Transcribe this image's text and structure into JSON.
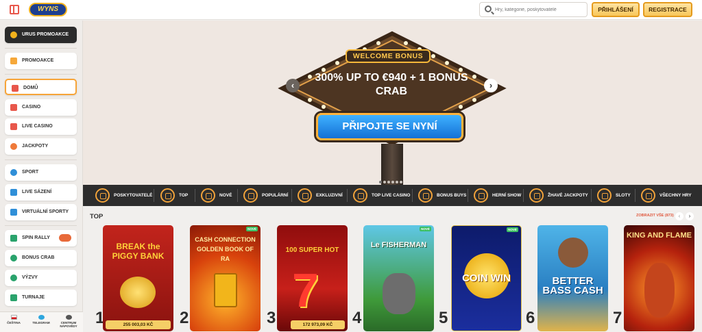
{
  "header": {
    "logo_text": "WYNS",
    "search_placeholder": "Hry, kategorie, poskytovatelé",
    "login_label": "PŘIHLÁŠENÍ",
    "register_label": "REGISTRACE"
  },
  "sidebar": {
    "items": [
      {
        "label": "URUS PROMOAKCE"
      },
      {
        "label": "PROMOAKCE"
      },
      {
        "label": "DOMŮ"
      },
      {
        "label": "CASINO"
      },
      {
        "label": "LIVE CASINO"
      },
      {
        "label": "JACKPOTY"
      },
      {
        "label": "SPORT"
      },
      {
        "label": "LIVE SÁZENÍ"
      },
      {
        "label": "VIRTUÁLNÍ SPORTY"
      },
      {
        "label": "SPIN RALLY"
      },
      {
        "label": "BONUS CRAB"
      },
      {
        "label": "VÝZVY"
      },
      {
        "label": "TURNAJE"
      }
    ],
    "footer": [
      {
        "label": "ČEŠTINA"
      },
      {
        "label": "TELEGRAM"
      },
      {
        "label": "CENTRUM NÁPOVĚDY"
      }
    ]
  },
  "hero": {
    "badge": "WELCOME BONUS",
    "offer": "300% UP TO €940 + 1 BONUS CRAB",
    "cta": "PŘIPOJTE SE NYNÍ",
    "prev": "‹",
    "next": "›"
  },
  "categories": [
    {
      "label": "POSKYTOVATELÉ"
    },
    {
      "label": "TOP"
    },
    {
      "label": "NOVÉ"
    },
    {
      "label": "POPULÁRNÍ"
    },
    {
      "label": "EXKLUZIVNÍ"
    },
    {
      "label": "TOP LIVE CASINO"
    },
    {
      "label": "BONUS BUYS"
    },
    {
      "label": "HERNÍ SHOW"
    },
    {
      "label": "ŽHAVÉ JACKPOTY"
    },
    {
      "label": "SLOTY"
    },
    {
      "label": "VŠECHNY HRY"
    }
  ],
  "top_section": {
    "title": "TOP",
    "show_all": "ZOBRAZIT VŠE (873)",
    "prev": "‹",
    "next": "›",
    "new_badge": "NOVÉ",
    "games": [
      {
        "rank": "1",
        "title": "BREAK the PIGGY BANK",
        "jackpot": "255 003,03 KČ"
      },
      {
        "rank": "2",
        "title": "CASH CONNECTION GOLDEN BOOK OF RA",
        "jackpot": ""
      },
      {
        "rank": "3",
        "title": "100 SUPER HOT",
        "jackpot": "172 973,09 KČ"
      },
      {
        "rank": "4",
        "title": "Le FISHERMAN",
        "jackpot": ""
      },
      {
        "rank": "5",
        "title": "COIN WIN",
        "jackpot": ""
      },
      {
        "rank": "6",
        "title": "BETTER BASS CASH",
        "jackpot": ""
      },
      {
        "rank": "7",
        "title": "KING AND FLAME",
        "jackpot": ""
      }
    ]
  }
}
